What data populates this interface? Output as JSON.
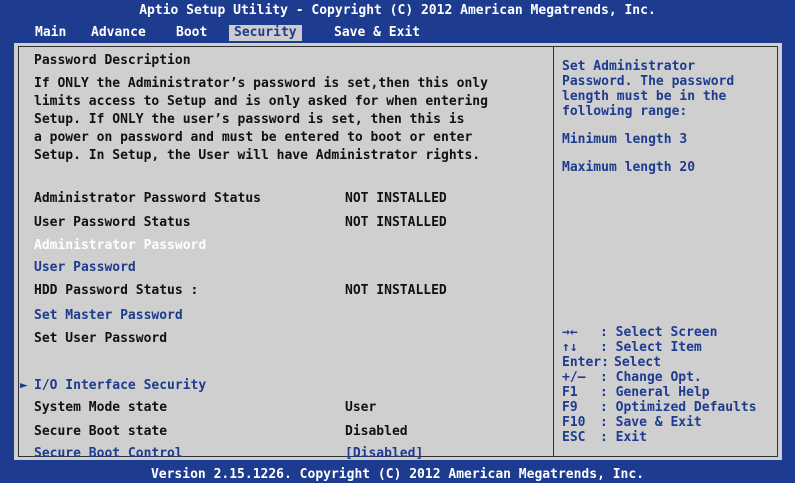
{
  "title": "Aptio Setup Utility - Copyright (C) 2012 American Megatrends, Inc.",
  "menu": [
    {
      "label": "Main"
    },
    {
      "label": "Advance"
    },
    {
      "label": "Boot"
    },
    {
      "label": "Security",
      "active": true
    },
    {
      "label": "Save & Exit"
    }
  ],
  "description": {
    "heading": "Password Description",
    "body": "If ONLY the Administrator’s password is set,then this only\nlimits access to Setup and is only asked for when entering\nSetup. If ONLY the user’s password is set, then this is\na power on password and must be entered to boot or enter\nSetup. In Setup, the User will have Administrator rights."
  },
  "items": {
    "admin_status": {
      "label": "Administrator Password Status",
      "value": "NOT INSTALLED"
    },
    "user_status": {
      "label": "User Password Status",
      "value": "NOT INSTALLED"
    },
    "admin_password": {
      "label": "Administrator Password"
    },
    "user_password": {
      "label": "User Password"
    },
    "hdd_status": {
      "label": "HDD Password Status :",
      "value": "NOT INSTALLED"
    },
    "set_master": {
      "label": "Set Master Password"
    },
    "set_user": {
      "label": "Set User Password"
    },
    "io_security": {
      "label": "I/O Interface Security",
      "marker": "►"
    },
    "system_mode": {
      "label": "System Mode state",
      "value": "User"
    },
    "secure_boot_state": {
      "label": "Secure Boot state",
      "value": "Disabled"
    },
    "secure_boot_control": {
      "label": "Secure Boot Control",
      "value": "[Disabled]"
    }
  },
  "help": {
    "lines": [
      "Set Administrator",
      "Password. The password",
      "length must be in the",
      "following range:"
    ],
    "min": "Minimum length 3",
    "max": "Maximum length 20"
  },
  "keys": [
    {
      "key": "→←",
      "desc": ": Select Screen"
    },
    {
      "key": "↑↓",
      "desc": ": Select Item"
    },
    {
      "key": "Enter:",
      "desc": "Select"
    },
    {
      "key": "+/—",
      "desc": ": Change Opt."
    },
    {
      "key": "F1",
      "desc": ": General Help"
    },
    {
      "key": "F9",
      "desc": ": Optimized Defaults"
    },
    {
      "key": "F10",
      "desc": ": Save & Exit"
    },
    {
      "key": "ESC",
      "desc": ": Exit"
    }
  ],
  "footer": "Version 2.15.1226. Copyright (C) 2012 American Megatrends, Inc.",
  "colors": {
    "background": "#1d3b8f",
    "panel": "#cfcfcf",
    "highlight_text": "#ffffff",
    "accent": "#1d3b8f"
  }
}
